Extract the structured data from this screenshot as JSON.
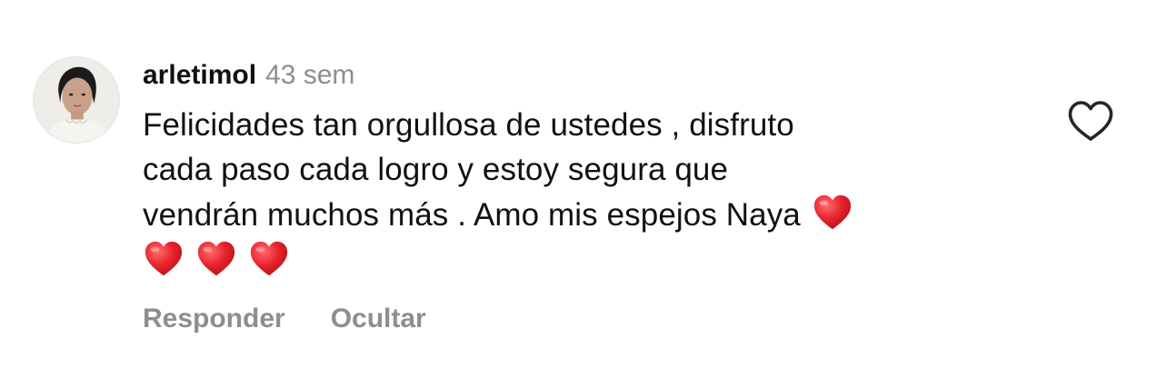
{
  "comment": {
    "username": "arletimol",
    "timestamp": "43 sem",
    "text_lines": [
      "Felicidades tan orgullosa de ustedes , disfruto",
      "cada paso cada logro y estoy segura que",
      "vendrán muchos más . Amo mis espejos Naya"
    ],
    "emoji_inline": "❤️",
    "emoji_trailing": [
      "❤️",
      "❤️",
      "❤️"
    ],
    "actions": {
      "reply_label": "Responder",
      "hide_label": "Ocultar"
    },
    "like_icon": "heart-outline-icon",
    "avatar_icon": "profile-avatar"
  },
  "colors": {
    "text": "#111111",
    "muted": "#8e8e8e",
    "emoji_red": "#e0202a",
    "background": "#ffffff"
  }
}
